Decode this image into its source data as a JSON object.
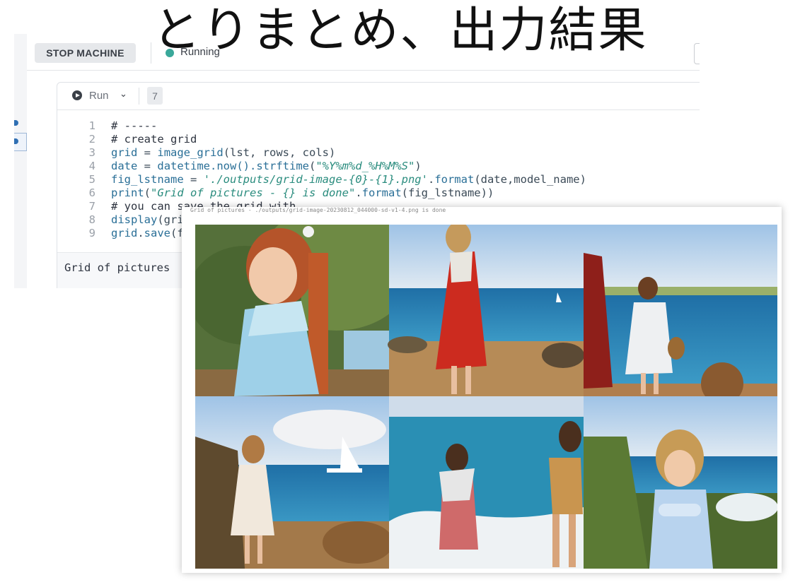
{
  "slide": {
    "title": "とりまとめ、出力結果"
  },
  "toolbar": {
    "stop_label": "STOP MACHINE",
    "status_label": "Running",
    "status_color": "#3aa89a"
  },
  "cell": {
    "run_label": "Run",
    "execution_count": "7",
    "lines": [
      {
        "n": "1",
        "html": "<span class='c-com'># -----</span>"
      },
      {
        "n": "2",
        "html": "<span class='c-com'># create grid</span>"
      },
      {
        "n": "3",
        "html": "<span class='c-def'>grid</span> <span class='c-plain'>=</span> <span class='c-fn'>image_grid</span><span class='c-plain'>(lst, rows, cols)</span>"
      },
      {
        "n": "4",
        "html": "<span class='c-def'>date</span> <span class='c-plain'>=</span> <span class='c-fn'>datetime.now().strftime</span><span class='c-plain'>(</span><span class='c-str'>\"%Y%m%d_%H%M%S\"</span><span class='c-plain'>)</span>"
      },
      {
        "n": "5",
        "html": "<span class='c-def'>fig_lstname</span> <span class='c-plain'>=</span> <span class='c-str'>'./outputs/grid-image-{0}-{1}.png'</span><span class='c-plain'>.</span><span class='c-fn'>format</span><span class='c-plain'>(date,model_name)</span>"
      },
      {
        "n": "6",
        "html": "<span class='c-fn'>print</span><span class='c-plain'>(</span><span class='c-str'>\"Grid of pictures - {} is done\"</span><span class='c-plain'>.</span><span class='c-fn'>format</span><span class='c-plain'>(fig_lstname))</span>"
      },
      {
        "n": "7",
        "html": "<span class='c-com'># you can save the grid with</span>"
      },
      {
        "n": "8",
        "html": "<span class='c-fn'>display</span><span class='c-plain'>(grid)</span>"
      },
      {
        "n": "9",
        "html": "<span class='c-def'>grid</span><span class='c-plain'>.</span><span class='c-fn'>save</span><span class='c-plain'>(fig_lstname)</span>"
      }
    ],
    "output_text": "Grid of pictures"
  },
  "overlay": {
    "caption": "Grid of pictures - ./outputs/grid-image-20230812_044000-sd-v1-4.png is done",
    "grid_rows": 2,
    "grid_cols": 3
  }
}
